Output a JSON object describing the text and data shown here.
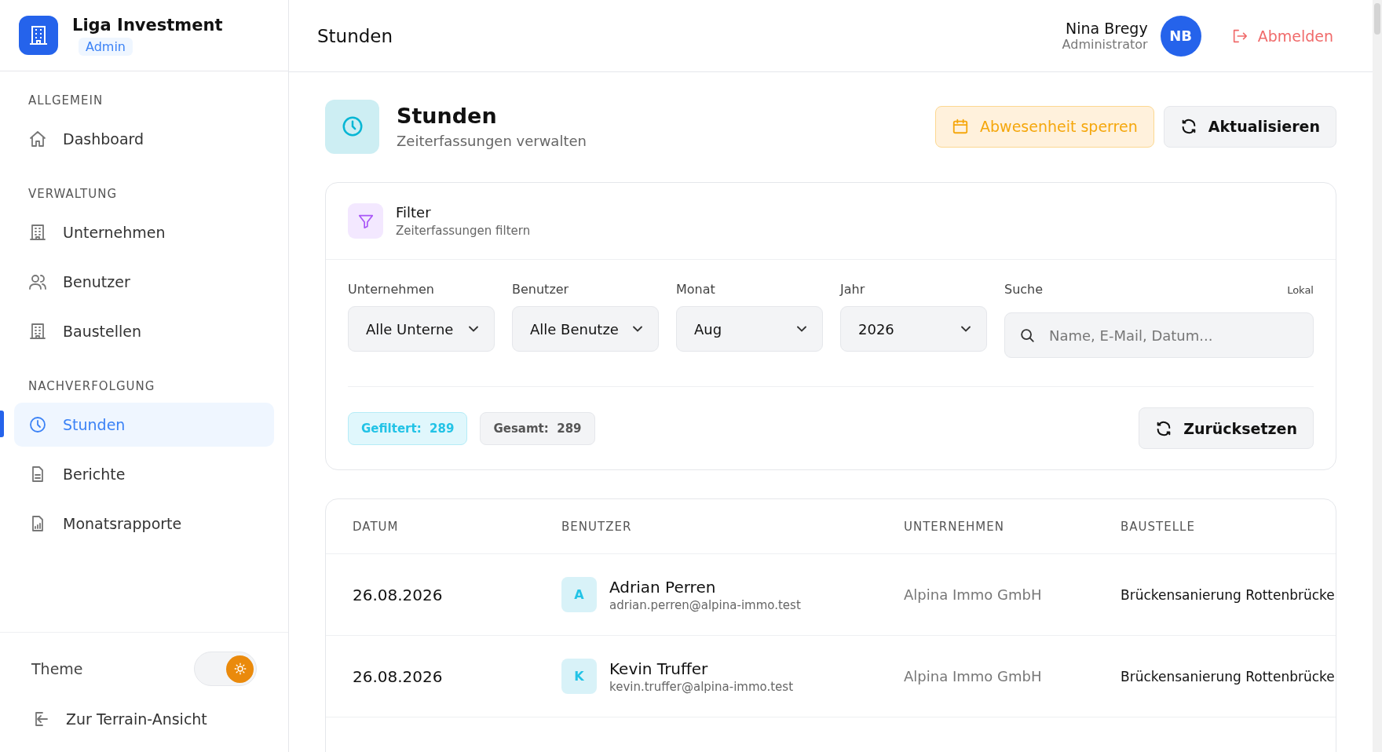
{
  "brand": {
    "name": "Liga Investment",
    "badge": "Admin"
  },
  "sidebar": {
    "sections": [
      {
        "title": "ALLGEMEIN",
        "items": [
          {
            "label": "Dashboard",
            "selected": false
          }
        ]
      },
      {
        "title": "VERWALTUNG",
        "items": [
          {
            "label": "Unternehmen",
            "selected": false
          },
          {
            "label": "Benutzer",
            "selected": false
          },
          {
            "label": "Baustellen",
            "selected": false
          }
        ]
      },
      {
        "title": "NACHVERFOLGUNG",
        "items": [
          {
            "label": "Stunden",
            "selected": true
          },
          {
            "label": "Berichte",
            "selected": false
          },
          {
            "label": "Monatsrapporte",
            "selected": false
          }
        ]
      }
    ],
    "theme": {
      "label": "Theme",
      "dark": false
    },
    "back_link": "Zur Terrain-Ansicht"
  },
  "header": {
    "title": "Stunden",
    "user": {
      "name": "Nina Bregy",
      "role": "Administrator",
      "initials": "NB"
    },
    "logout": "Abmelden"
  },
  "page": {
    "title": "Stunden",
    "subtitle": "Zeiterfassungen verwalten",
    "actions": [
      {
        "label": "Abwesenheit sperren",
        "kind": "warning"
      },
      {
        "label": "Aktualisieren",
        "kind": "neutral"
      }
    ]
  },
  "filter": {
    "title": "Filter",
    "subtitle": "Zeiterfassungen filtern",
    "selects": [
      {
        "label": "Unternehmen",
        "value": "Alle Unterne"
      },
      {
        "label": "Benutzer",
        "value": "Alle Benutze"
      },
      {
        "label": "Monat",
        "value": "Aug"
      },
      {
        "label": "Jahr",
        "value": "2026"
      }
    ],
    "search": {
      "label": "Suche",
      "hint": "Lokal",
      "placeholder": "Name, E-Mail, Datum..."
    },
    "counts": [
      {
        "label": "Gefiltert:",
        "value": "289",
        "kind": "accent"
      },
      {
        "label": "Gesamt:",
        "value": "289",
        "kind": "neutral"
      }
    ],
    "reset": "Zurücksetzen"
  },
  "table": {
    "columns": [
      "DATUM",
      "BENUTZER",
      "UNTERNEHMEN",
      "BAUSTELLE"
    ],
    "rows": [
      {
        "date": "26.08.2026",
        "initial": "A",
        "name": "Adrian Perren",
        "email": "adrian.perren@alpina-immo.test",
        "company": "Alpina Immo GmbH",
        "site": "Brückensanierung Rottenbrücke"
      },
      {
        "date": "26.08.2026",
        "initial": "K",
        "name": "Kevin Truffer",
        "email": "kevin.truffer@alpina-immo.test",
        "company": "Alpina Immo GmbH",
        "site": "Brückensanierung Rottenbrücke"
      }
    ]
  }
}
